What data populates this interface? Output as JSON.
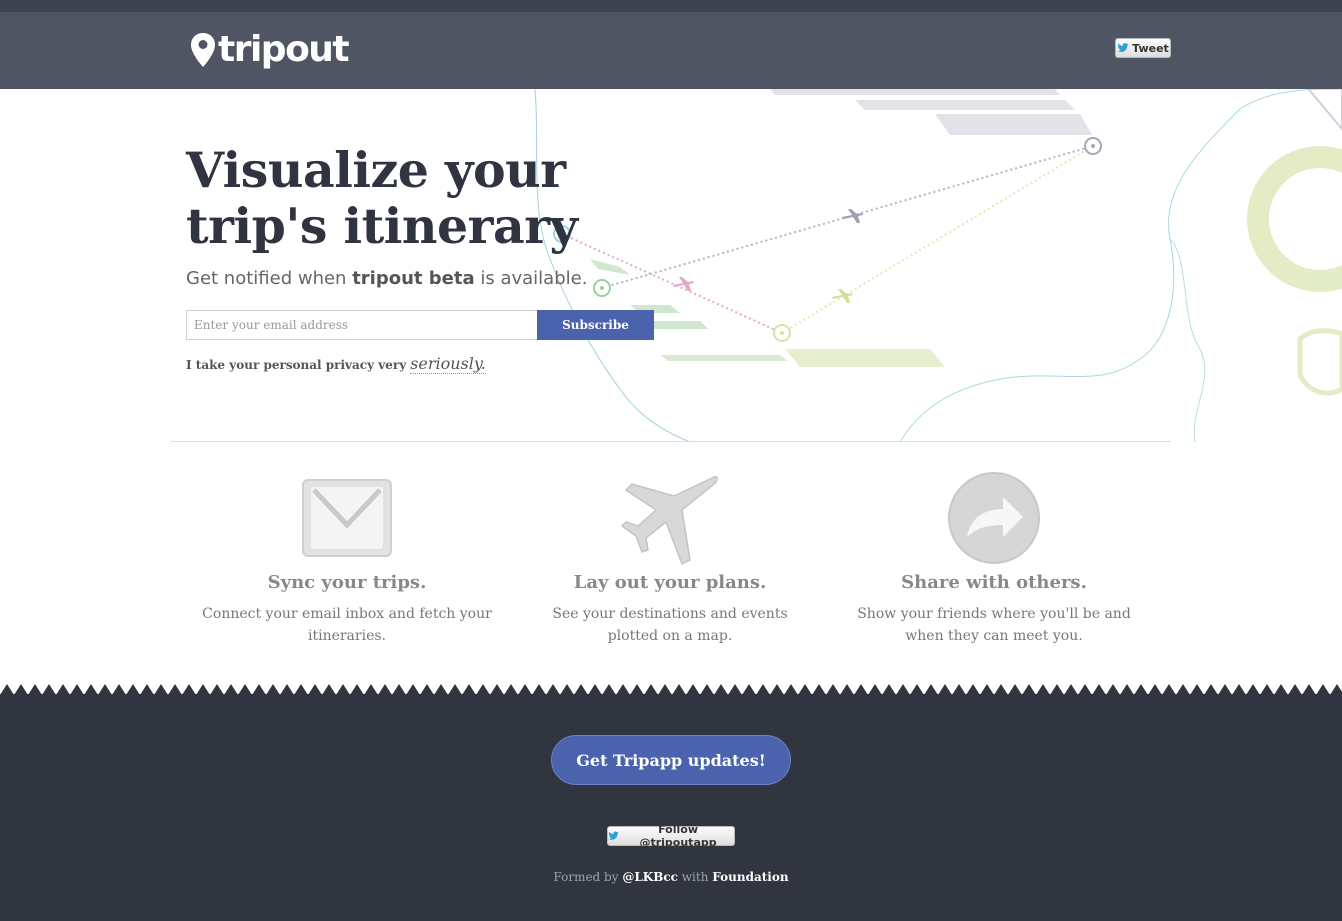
{
  "header": {
    "logo_text": "tripout",
    "tweet_label": "Tweet"
  },
  "hero": {
    "title_line1": "Visualize your",
    "title_line2": "trip's itinerary",
    "subtitle_prefix": "Get notified when ",
    "subtitle_bold": "tripout beta",
    "subtitle_suffix": " is available.",
    "email_placeholder": "Enter your email address",
    "subscribe_label": "Subscribe",
    "privacy_text": "I take your personal privacy very",
    "privacy_script": "seriously."
  },
  "features": [
    {
      "title": "Sync your trips.",
      "description": "Connect your email inbox and fetch your itineraries.",
      "icon": "envelope-icon"
    },
    {
      "title": "Lay out your plans.",
      "description": "See your destinations and events plotted on a map.",
      "icon": "airplane-icon"
    },
    {
      "title": "Share with others.",
      "description": "Show your friends where you'll be and when they can meet you.",
      "icon": "share-arrow-icon"
    }
  ],
  "footer": {
    "cta_label": "Get Tripapp updates!",
    "follow_label": "Follow @tripoutapp",
    "credits_prefix": "Formed by ",
    "credits_author": "@LKBcc",
    "credits_middle": " with ",
    "credits_framework": "Foundation"
  },
  "colors": {
    "header_bg": "#4f5563",
    "footer_bg": "#303540",
    "accent_blue": "#4b63ad",
    "title_dark": "#2f3440"
  }
}
